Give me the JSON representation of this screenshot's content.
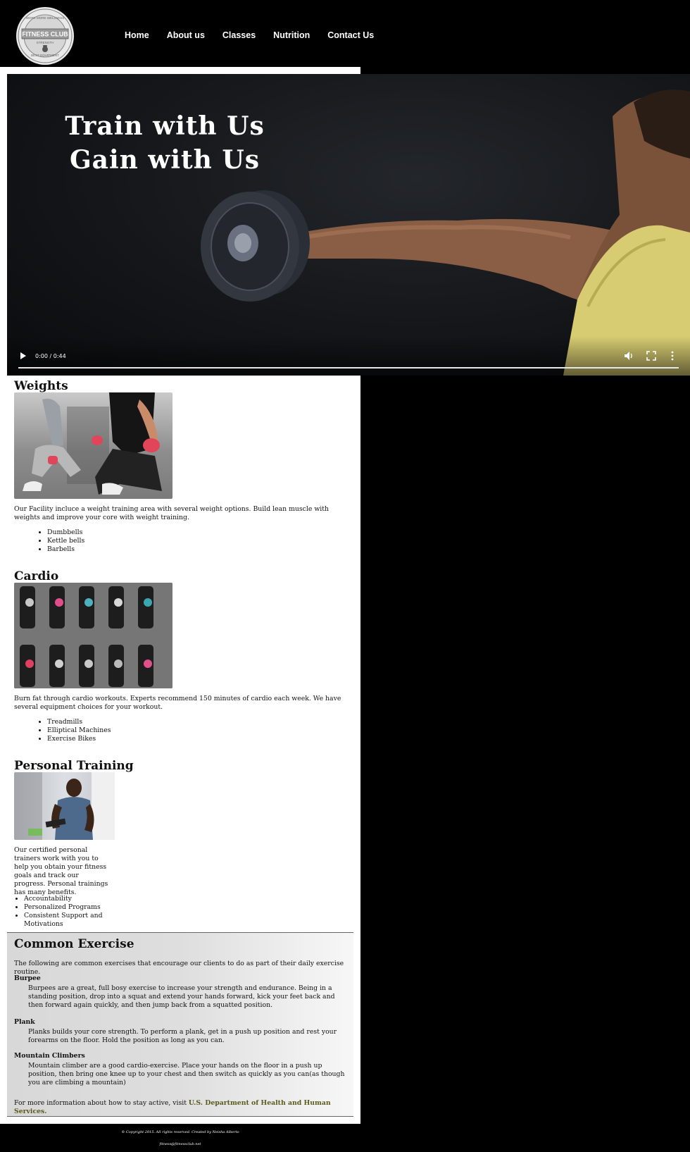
{
  "brand": {
    "logo_top": "WORK MORE WELLNESS",
    "logo_main": "FITNESS CLUB",
    "logo_sub": "STRENGTH",
    "logo_bottom": "BEST EQUIPMENT"
  },
  "nav": {
    "items": [
      {
        "label": "Home"
      },
      {
        "label": "About us"
      },
      {
        "label": "Classes"
      },
      {
        "label": "Nutrition"
      },
      {
        "label": "Contact Us"
      }
    ]
  },
  "video": {
    "headline_line1": "Train with Us",
    "headline_line2": "Gain with Us",
    "time_display": "0:00 / 0:44",
    "progress": 0
  },
  "weights": {
    "title": "Weights",
    "text": "Our Facility incluce a weight training area with several weight options. Build lean muscle with weights and improve your core with weight training.",
    "items": [
      "Dumbbells",
      "Kettle bells",
      "Barbells"
    ]
  },
  "cardio": {
    "title": "Cardio",
    "text": "Burn fat through cardio workouts. Experts recommend 150 minutes of cardio each week. We have several equipment choices for your workout.",
    "items": [
      "Treadmills",
      "Elliptical Machines",
      "Exercise Bikes"
    ]
  },
  "training": {
    "title": "Personal Training",
    "text": "Our certified personal trainers work with you to help you obtain your fitness goals and track our progress. Personal trainings has many benefits.",
    "items": [
      "Accountability",
      "Personalized Programs",
      "Consistent Support and Motivations"
    ]
  },
  "common": {
    "title": "Common Exercise",
    "intro": "The following are common exercises that encourage our clients to do as part of their daily exercise routine.",
    "exercises": [
      {
        "name": "Burpee",
        "desc": "Burpees are a great, full bosy exercise to increase your strength and endurance. Being in a standing position, drop into a squat and extend your hands forward, kick your feet back and then forward again quickly, and then jump back from a squatted position."
      },
      {
        "name": "Plank",
        "desc": "Planks builds your core strength. To perform a plank, get in a push up position and rest your forearms on the floor. Hold the position as long as you can."
      },
      {
        "name": "Mountain Climbers",
        "desc": "Mountain climber are a good cardio-exercise. Place your hands on the floor in a push up position, then bring one knee up to your chest and then switch as quickly as you can(as though you are climbing a mountain)"
      }
    ],
    "more_prefix": "For more information about how to stay active, visit ",
    "more_link": "U.S. Department of Health and Human Services."
  },
  "footer": {
    "copyright": "© Copyright 2015. All rights reserved. Created by Neisha Alberto",
    "email": "fitness@fitnessclub.net"
  },
  "icons": {
    "play": "play-icon",
    "volume": "volume-icon",
    "fullscreen": "fullscreen-icon",
    "more": "more-vertical-icon"
  }
}
